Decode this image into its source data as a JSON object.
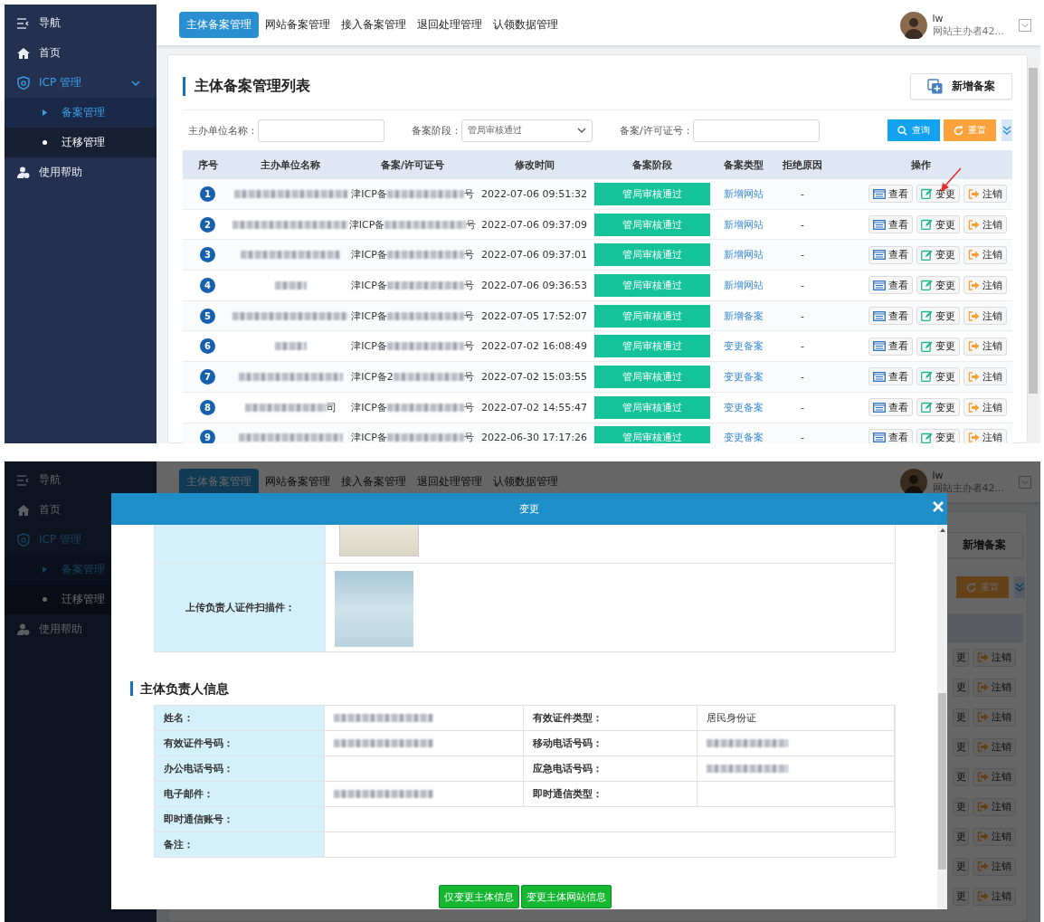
{
  "top_screen": {
    "sidebar": {
      "title": "导航",
      "items": [
        {
          "label": "首页",
          "kind": "link",
          "selected": false
        },
        {
          "label": "ICP 管理",
          "kind": "group",
          "selected": true,
          "expanded": true,
          "children": [
            {
              "label": "备案管理",
              "selected": true
            },
            {
              "label": "迁移管理",
              "selected": false
            }
          ]
        },
        {
          "label": "使用帮助",
          "kind": "link",
          "selected": false
        }
      ]
    },
    "tabs": [
      {
        "label": "主体备案管理",
        "selected": true
      },
      {
        "label": "网站备案管理",
        "selected": false
      },
      {
        "label": "接入备案管理",
        "selected": false
      },
      {
        "label": "退回处理管理",
        "selected": false
      },
      {
        "label": "认领数据管理",
        "selected": false
      }
    ],
    "user": {
      "name": "lw",
      "role": "网站主办者42..."
    },
    "card": {
      "title": "主体备案管理列表",
      "add_button": "新增备案"
    },
    "filters": [
      {
        "label": "主办单位名称：",
        "kind": "input"
      },
      {
        "label": "备案阶段：",
        "kind": "select",
        "value": "管局审核通过"
      },
      {
        "label": "备案/许可证号：",
        "kind": "input"
      }
    ],
    "search_button": "查询",
    "reset_button": "重置",
    "table": {
      "columns": [
        "序号",
        "主办单位名称",
        "备案/许可证号",
        "修改时间",
        "备案阶段",
        "备案类型",
        "拒绝原因",
        "操作"
      ],
      "rows": [
        {
          "no": "1",
          "license_prefix": "津ICP备",
          "license_suffix": "号",
          "modified": "2022-07-06 09:51:32",
          "stage": "管局审核通过",
          "type": "新增网站",
          "reason": "-",
          "actions": [
            "查看",
            "变更",
            "注销"
          ]
        },
        {
          "no": "2",
          "license_prefix": "津ICP备",
          "license_suffix": "号",
          "modified": "2022-07-06 09:37:09",
          "stage": "管局审核通过",
          "type": "新增网站",
          "reason": "-",
          "actions": [
            "查看",
            "变更",
            "注销"
          ]
        },
        {
          "no": "3",
          "license_prefix": "津ICP备",
          "license_suffix": "号",
          "modified": "2022-07-06 09:37:01",
          "stage": "管局审核通过",
          "type": "新增网站",
          "reason": "-",
          "actions": [
            "查看",
            "变更",
            "注销"
          ]
        },
        {
          "no": "4",
          "license_prefix": "津ICP备",
          "license_suffix": "号",
          "modified": "2022-07-06 09:36:53",
          "stage": "管局审核通过",
          "type": "新增网站",
          "reason": "-",
          "actions": [
            "查看",
            "变更",
            "注销"
          ]
        },
        {
          "no": "5",
          "license_prefix": "津ICP备",
          "license_suffix": "号",
          "modified": "2022-07-05 17:52:07",
          "stage": "管局审核通过",
          "type": "新增备案",
          "reason": "-",
          "actions": [
            "查看",
            "变更",
            "注销"
          ]
        },
        {
          "no": "6",
          "license_prefix": "津ICP备",
          "license_suffix": "号",
          "modified": "2022-07-02 16:08:49",
          "stage": "管局审核通过",
          "type": "变更备案",
          "reason": "-",
          "actions": [
            "查看",
            "变更",
            "注销"
          ]
        },
        {
          "no": "7",
          "license_prefix": "津ICP备2",
          "license_suffix": "号",
          "modified": "2022-07-02 15:03:55",
          "stage": "管局审核通过",
          "type": "变更备案",
          "reason": "-",
          "actions": [
            "查看",
            "变更",
            "注销"
          ]
        },
        {
          "no": "8",
          "name_tail": "司",
          "license_prefix": "津ICP备",
          "license_suffix": "号",
          "modified": "2022-07-02 14:55:47",
          "stage": "管局审核通过",
          "type": "变更备案",
          "reason": "-",
          "actions": [
            "查看",
            "变更",
            "注销"
          ]
        },
        {
          "no": "9",
          "license_prefix": "津ICP备",
          "license_suffix": "号",
          "modified": "2022-06-30 17:17:26",
          "stage": "管局审核通过",
          "type": "变更备案",
          "reason": "-",
          "actions": [
            "查看",
            "变更",
            "注销"
          ]
        }
      ]
    }
  },
  "bottom_screen": {
    "sidebar": {
      "title": "导航",
      "items": [
        {
          "label": "首页",
          "kind": "link",
          "selected": false
        },
        {
          "label": "ICP 管理",
          "kind": "group",
          "selected": true,
          "children": [
            {
              "label": "备案管理",
              "selected": true
            },
            {
              "label": "迁移管理",
              "selected": false
            }
          ]
        },
        {
          "label": "使用帮助",
          "kind": "link",
          "selected": false
        }
      ]
    },
    "tabs": [
      {
        "label": "主体备案管理",
        "selected": true
      },
      {
        "label": "网站备案管理",
        "selected": false
      },
      {
        "label": "接入备案管理",
        "selected": false
      },
      {
        "label": "退回处理管理",
        "selected": false
      },
      {
        "label": "认领数据管理",
        "selected": false
      }
    ],
    "user": {
      "name": "lw",
      "role": "网站主办者42..."
    },
    "add_button": "新增备案",
    "reset_button": "重置",
    "rows": [
      {
        "edit": "更",
        "cancel": "注销"
      },
      {
        "edit": "更",
        "cancel": "注销"
      },
      {
        "edit": "更",
        "cancel": "注销"
      },
      {
        "edit": "更",
        "cancel": "注销"
      },
      {
        "edit": "更",
        "cancel": "注销"
      },
      {
        "edit": "更",
        "cancel": "注销"
      },
      {
        "edit": "更",
        "cancel": "注销"
      },
      {
        "edit": "更",
        "cancel": "注销"
      },
      {
        "edit": "更",
        "cancel": "注销"
      }
    ],
    "modal": {
      "title": "变更",
      "attachment_rows": [
        {
          "kind": "cut"
        },
        {
          "kind": "full",
          "label": "上传负责人证件扫描件："
        }
      ],
      "section_title": "主体负责人信息",
      "info_rows": [
        {
          "cells": [
            {
              "kind": "label",
              "text": "姓名："
            },
            {
              "kind": "blurred"
            },
            {
              "kind": "label",
              "text": "有效证件类型："
            },
            {
              "kind": "value",
              "text": "居民身份证"
            }
          ]
        },
        {
          "cells": [
            {
              "kind": "label",
              "text": "有效证件号码："
            },
            {
              "kind": "blurred"
            },
            {
              "kind": "label",
              "text": "移动电话号码："
            },
            {
              "kind": "blurred"
            }
          ]
        },
        {
          "cells": [
            {
              "kind": "label",
              "text": "办公电话号码："
            },
            {
              "kind": "empty"
            },
            {
              "kind": "label",
              "text": "应急电话号码："
            },
            {
              "kind": "blurred"
            }
          ]
        },
        {
          "cells": [
            {
              "kind": "label",
              "text": "电子邮件："
            },
            {
              "kind": "blurred"
            },
            {
              "kind": "label",
              "text": "即时通信类型："
            },
            {
              "kind": "empty"
            }
          ]
        },
        {
          "cells": [
            {
              "kind": "label",
              "text": "即时通信账号："
            },
            {
              "kind": "wide"
            }
          ]
        },
        {
          "cells": [
            {
              "kind": "label",
              "text": "备注："
            },
            {
              "kind": "wide"
            }
          ]
        }
      ],
      "buttons": [
        "仅变更主体信息",
        "变更主体网站信息"
      ]
    }
  }
}
